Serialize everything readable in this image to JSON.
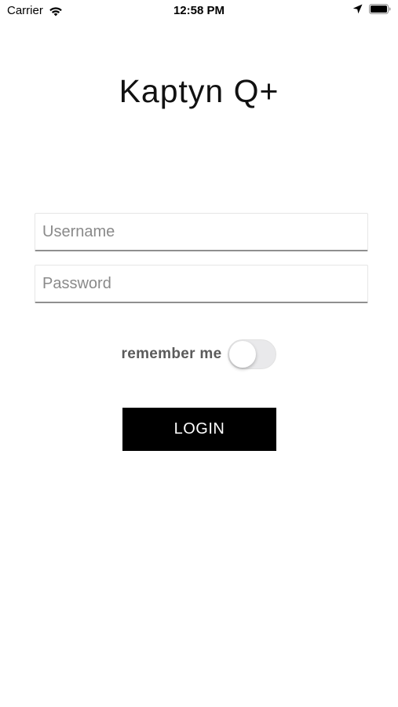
{
  "status_bar": {
    "carrier": "Carrier",
    "time": "12:58 PM",
    "icons": [
      "wifi-icon",
      "location-arrow-icon",
      "battery-icon"
    ]
  },
  "app": {
    "title": "Kaptyn Q+"
  },
  "form": {
    "username": {
      "value": "",
      "placeholder": "Username"
    },
    "password": {
      "value": "",
      "placeholder": "Password"
    },
    "remember_me": {
      "label": "remember me",
      "enabled": false
    },
    "login_label": "LOGIN"
  },
  "colors": {
    "background": "#ffffff",
    "button_background": "#000000",
    "button_text": "#ffffff",
    "toggle_off": "#e9e9eb",
    "label_text": "#5b5b5b",
    "placeholder_text": "#8a8a8a"
  }
}
